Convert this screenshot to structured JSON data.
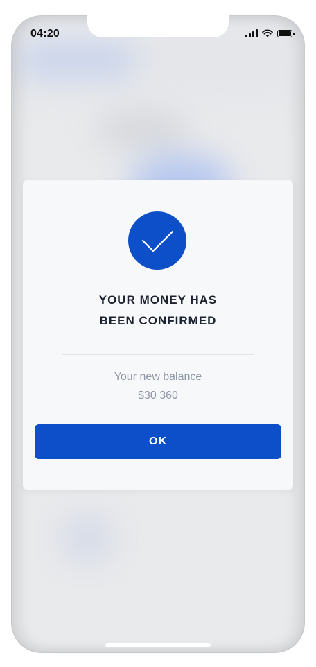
{
  "status_bar": {
    "time": "04:20",
    "icons": [
      "cellular-signal-icon",
      "wifi-icon",
      "battery-icon"
    ]
  },
  "dialog": {
    "icon": "checkmark-icon",
    "title_line1": "YOUR MONEY HAS",
    "title_line2": "BEEN CONFIRMED",
    "balance_label": "Your new balance",
    "balance_value": "$30 360",
    "ok_label": "OK"
  },
  "colors": {
    "accent": "#0d4fc9",
    "dialog_background": "#f7f8fa",
    "title_text": "#1c2230",
    "muted_text": "#8e96a6"
  }
}
